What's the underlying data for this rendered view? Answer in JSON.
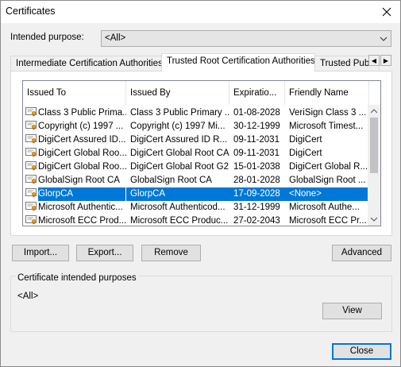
{
  "window": {
    "title": "Certificates"
  },
  "purpose": {
    "label": "Intended purpose:",
    "value": "<All>"
  },
  "tabs": [
    {
      "label": "Intermediate Certification Authorities",
      "active": false
    },
    {
      "label": "Trusted Root Certification Authorities",
      "active": true
    },
    {
      "label": "Trusted Publ",
      "active": false
    }
  ],
  "columns": [
    "Issued To",
    "Issued By",
    "Expiratio...",
    "Friendly Name"
  ],
  "rows": [
    {
      "issued_to": "Class 3 Public Prima...",
      "issued_by": "Class 3 Public Primary ...",
      "expiration": "01-08-2028",
      "friendly": "VeriSign Class 3 ...",
      "selected": false
    },
    {
      "issued_to": "Copyright (c) 1997 ...",
      "issued_by": "Copyright (c) 1997 Mi...",
      "expiration": "30-12-1999",
      "friendly": "Microsoft Timest...",
      "selected": false
    },
    {
      "issued_to": "DigiCert Assured ID...",
      "issued_by": "DigiCert Assured ID R...",
      "expiration": "09-11-2031",
      "friendly": "DigiCert",
      "selected": false
    },
    {
      "issued_to": "DigiCert Global Roo...",
      "issued_by": "DigiCert Global Root CA",
      "expiration": "09-11-2031",
      "friendly": "DigiCert",
      "selected": false
    },
    {
      "issued_to": "DigiCert Global Roo...",
      "issued_by": "DigiCert Global Root G2",
      "expiration": "15-01-2038",
      "friendly": "DigiCert Global R...",
      "selected": false
    },
    {
      "issued_to": "GlobalSign Root CA",
      "issued_by": "GlobalSign Root CA",
      "expiration": "28-01-2028",
      "friendly": "GlobalSign Root ...",
      "selected": false
    },
    {
      "issued_to": "GlorpCA",
      "issued_by": "GlorpCA",
      "expiration": "17-09-2028",
      "friendly": "<None>",
      "selected": true
    },
    {
      "issued_to": "Microsoft Authentic...",
      "issued_by": "Microsoft Authenticod...",
      "expiration": "31-12-1999",
      "friendly": "Microsoft Authe...",
      "selected": false
    },
    {
      "issued_to": "Microsoft ECC Prod...",
      "issued_by": "Microsoft ECC Produc...",
      "expiration": "27-02-2043",
      "friendly": "Microsoft ECC Pr...",
      "selected": false
    }
  ],
  "buttons": {
    "import": "Import...",
    "export": "Export...",
    "remove": "Remove",
    "advanced": "Advanced",
    "view": "View",
    "close": "Close"
  },
  "purposes_group": {
    "label": "Certificate intended purposes",
    "value": "<All>"
  },
  "icons": {
    "close": "close-icon",
    "dropdown": "chevron-down-icon",
    "cert": "certificate-icon",
    "tab_left": "tab-scroll-left-icon",
    "tab_right": "tab-scroll-right-icon"
  },
  "colors": {
    "selection": "#0078d7",
    "window_bg": "#f0f0f0",
    "default_button_border": "#0078d7"
  }
}
